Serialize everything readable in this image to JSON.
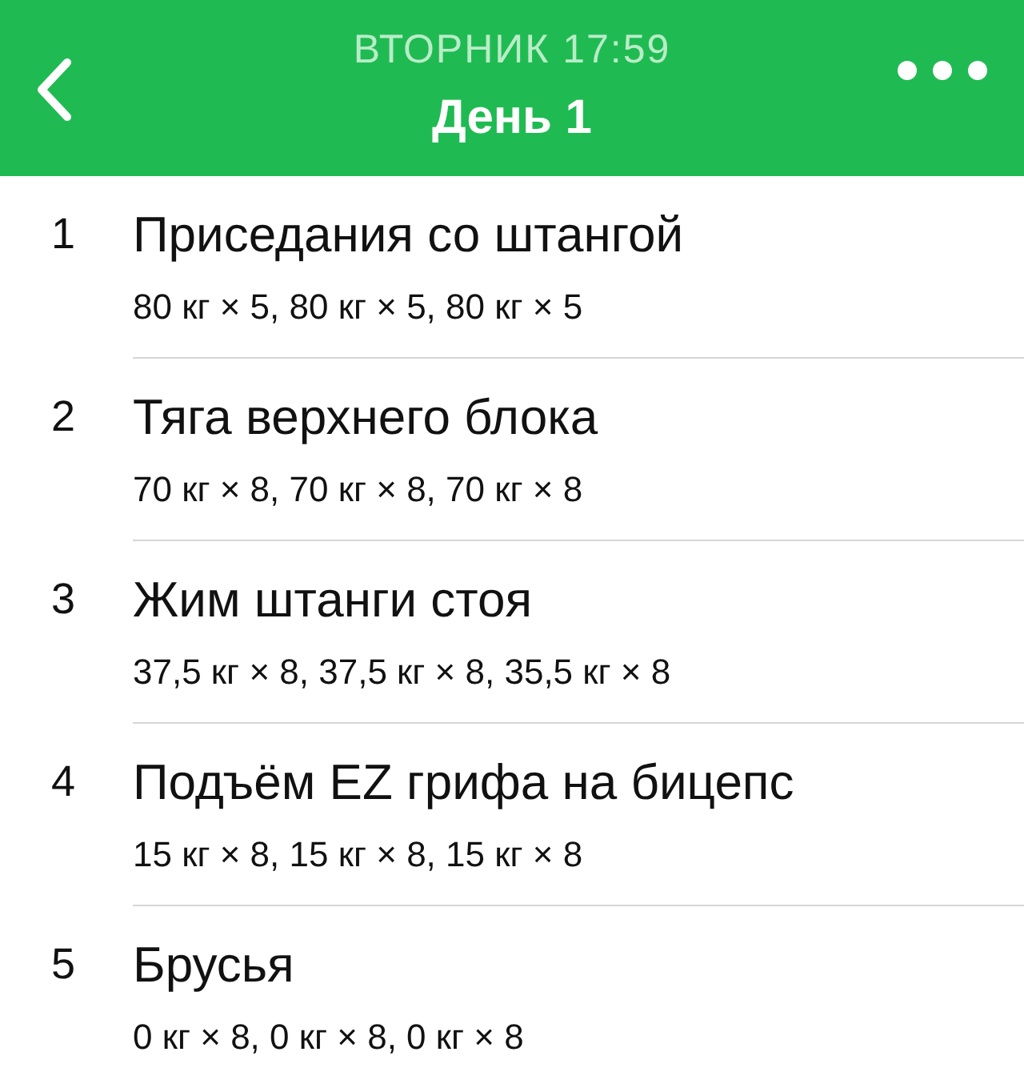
{
  "header": {
    "subtitle": "ВТОРНИК 17:59",
    "title": "День 1"
  },
  "exercises": [
    {
      "number": "1",
      "name": "Приседания со штангой",
      "sets": "80 кг × 5, 80 кг × 5, 80 кг × 5"
    },
    {
      "number": "2",
      "name": "Тяга верхнего блока",
      "sets": "70 кг × 8, 70 кг × 8, 70 кг × 8"
    },
    {
      "number": "3",
      "name": "Жим штанги стоя",
      "sets": "37,5 кг × 8, 37,5 кг × 8, 35,5 кг × 8"
    },
    {
      "number": "4",
      "name": "Подъём EZ грифа на бицепс",
      "sets": "15 кг × 8, 15 кг × 8, 15 кг × 8"
    },
    {
      "number": "5",
      "name": "Брусья",
      "sets": "0 кг × 8, 0 кг × 8, 0 кг × 8"
    }
  ]
}
